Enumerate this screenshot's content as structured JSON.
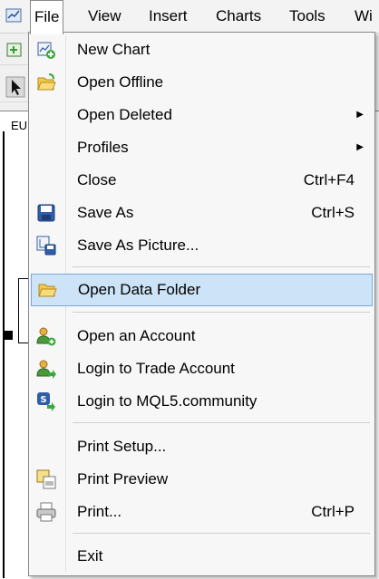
{
  "menubar": {
    "items": [
      {
        "label": "File",
        "active": true
      },
      {
        "label": "View"
      },
      {
        "label": "Insert"
      },
      {
        "label": "Charts"
      },
      {
        "label": "Tools"
      },
      {
        "label": "Wi"
      }
    ]
  },
  "background": {
    "chart_symbol": "EU"
  },
  "file_menu": {
    "items": [
      {
        "label": "New Chart",
        "icon": "new-chart-icon"
      },
      {
        "label": "Open Offline",
        "icon": "open-folder-icon"
      },
      {
        "label": "Open Deleted",
        "submenu": true
      },
      {
        "label": "Profiles",
        "submenu": true
      },
      {
        "label": "Close",
        "shortcut": "Ctrl+F4"
      },
      {
        "label": "Save As",
        "shortcut": "Ctrl+S",
        "icon": "save-icon"
      },
      {
        "label": "Save As Picture...",
        "icon": "save-picture-icon"
      },
      {
        "label": "Open Data Folder",
        "icon": "data-folder-icon",
        "highlighted": true
      },
      {
        "label": "Open an Account",
        "icon": "add-account-icon"
      },
      {
        "label": "Login to Trade Account",
        "icon": "login-account-icon"
      },
      {
        "label": "Login to MQL5.community",
        "icon": "mql5-login-icon"
      },
      {
        "label": "Print Setup..."
      },
      {
        "label": "Print Preview",
        "icon": "print-preview-icon"
      },
      {
        "label": "Print...",
        "shortcut": "Ctrl+P",
        "icon": "printer-icon"
      },
      {
        "label": "Exit"
      }
    ]
  },
  "colors": {
    "highlight_bg": "#cde3f7",
    "highlight_border": "#7aa7d8",
    "menu_bg": "#f7f7f7"
  }
}
